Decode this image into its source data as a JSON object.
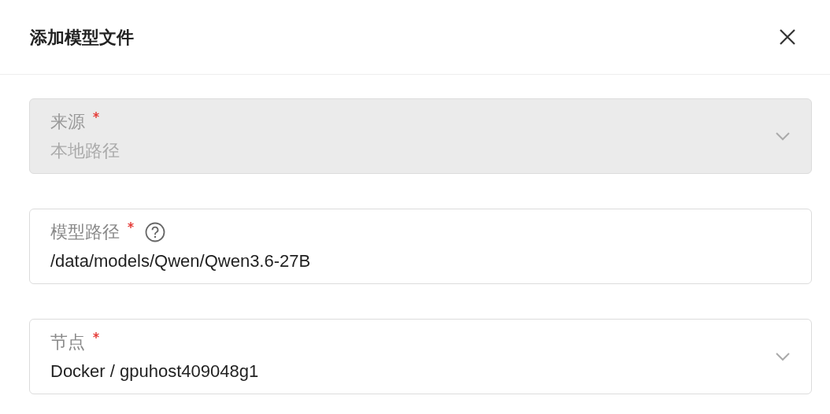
{
  "dialog": {
    "title": "添加模型文件",
    "fields": [
      {
        "kind": "select",
        "label": "来源",
        "required": true,
        "help": false,
        "value": "本地路径",
        "disabled": true
      },
      {
        "kind": "input",
        "label": "模型路径",
        "required": true,
        "help": true,
        "value": "/data/models/Qwen/Qwen3.6-27B",
        "disabled": false
      },
      {
        "kind": "select",
        "label": "节点",
        "required": true,
        "help": false,
        "value": "Docker / gpuhost409048g1",
        "disabled": false
      }
    ]
  }
}
